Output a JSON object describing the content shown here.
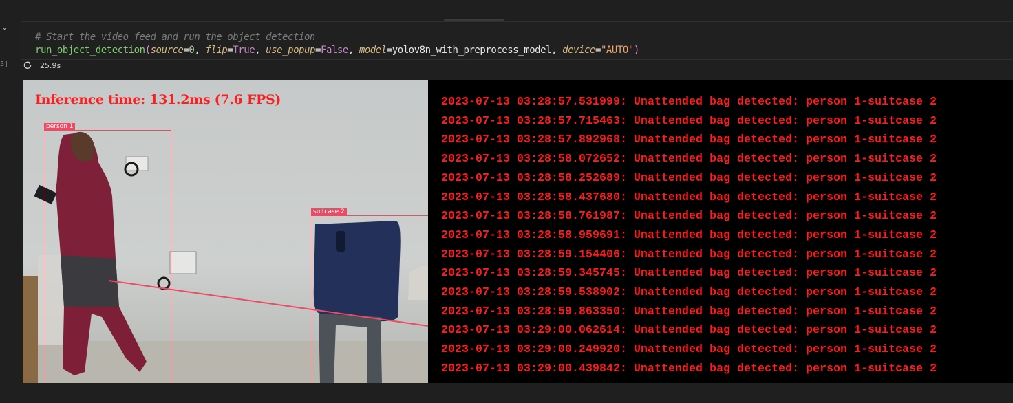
{
  "cell": {
    "collapse_icon": "chevron-down-icon",
    "exec_count": "3]",
    "code": {
      "comment": "# Start the video feed and run the object detection",
      "function": "run_object_detection",
      "params": [
        {
          "name": "source",
          "value": "0",
          "value_type": "num"
        },
        {
          "name": "flip",
          "value": "True",
          "value_type": "kw"
        },
        {
          "name": "use_popup",
          "value": "False",
          "value_type": "kw"
        },
        {
          "name": "model",
          "value": "yolov8n_with_preprocess_model",
          "value_type": "plain"
        },
        {
          "name": "device",
          "value": "\"AUTO\"",
          "value_type": "str"
        }
      ]
    },
    "status": {
      "icon": "refresh-icon",
      "time": "25.9s"
    }
  },
  "output": {
    "video": {
      "inference_text": "Inference time: 131.2ms (7.6 FPS)",
      "detections": [
        {
          "label": "person 1"
        },
        {
          "label": "suitcase 2"
        }
      ]
    },
    "log": [
      "2023-07-13 03:28:57.531999: Unattended bag detected: person 1-suitcase 2",
      "2023-07-13 03:28:57.715463: Unattended bag detected: person 1-suitcase 2",
      "2023-07-13 03:28:57.892968: Unattended bag detected: person 1-suitcase 2",
      "2023-07-13 03:28:58.072652: Unattended bag detected: person 1-suitcase 2",
      "2023-07-13 03:28:58.252689: Unattended bag detected: person 1-suitcase 2",
      "2023-07-13 03:28:58.437680: Unattended bag detected: person 1-suitcase 2",
      "2023-07-13 03:28:58.761987: Unattended bag detected: person 1-suitcase 2",
      "2023-07-13 03:28:58.959691: Unattended bag detected: person 1-suitcase 2",
      "2023-07-13 03:28:59.154406: Unattended bag detected: person 1-suitcase 2",
      "2023-07-13 03:28:59.345745: Unattended bag detected: person 1-suitcase 2",
      "2023-07-13 03:28:59.538902: Unattended bag detected: person 1-suitcase 2",
      "2023-07-13 03:28:59.863350: Unattended bag detected: person 1-suitcase 2",
      "2023-07-13 03:29:00.062614: Unattended bag detected: person 1-suitcase 2",
      "2023-07-13 03:29:00.249920: Unattended bag detected: person 1-suitcase 2",
      "2023-07-13 03:29:00.439842: Unattended bag detected: person 1-suitcase 2"
    ]
  }
}
